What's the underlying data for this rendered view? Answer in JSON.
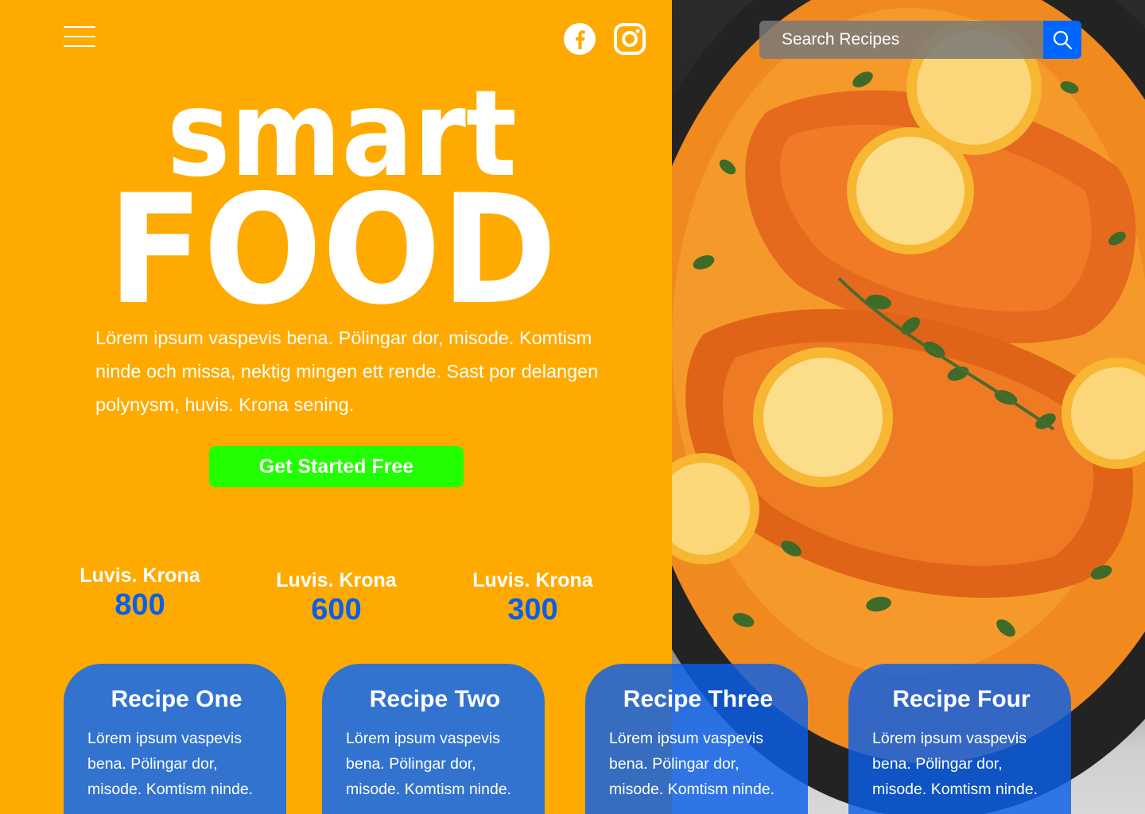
{
  "header": {
    "menu_icon": "hamburger-menu-icon",
    "social": [
      {
        "name": "facebook-icon"
      },
      {
        "name": "instagram-icon"
      }
    ],
    "search": {
      "placeholder": "Search Recipes",
      "icon": "search-icon"
    }
  },
  "hero": {
    "logo_text_top": "smart",
    "logo_text_bottom": "FOOD",
    "description": "Lörem ipsum vaspevis bena. Pölingar dor, misode. Komtism ninde och missa, nektig mingen ett rende. Sast por delangen polynysm, huvis. Krona sening.",
    "cta_label": "Get Started Free"
  },
  "stats": [
    {
      "label": "Luvis. Krona",
      "value": "800"
    },
    {
      "label": "Luvis. Krona",
      "value": "600"
    },
    {
      "label": "Luvis. Krona",
      "value": "300"
    }
  ],
  "recipes": [
    {
      "title": "Recipe One",
      "description": "Lörem ipsum vaspevis bena. Pölingar dor, misode. Komtism ninde."
    },
    {
      "title": "Recipe Two",
      "description": "Lörem ipsum vaspevis bena. Pölingar dor, misode. Komtism ninde."
    },
    {
      "title": "Recipe Three",
      "description": "Lörem ipsum vaspevis bena. Pölingar dor, misode. Komtism ninde."
    },
    {
      "title": "Recipe Four",
      "description": "Lörem ipsum vaspevis bena. Pölingar dor, misode. Komtism ninde."
    }
  ],
  "colors": {
    "background": "#FFAA00",
    "cta": "#22FF00",
    "stat_value": "#0A5FE8",
    "card": "#3273CF",
    "search_button": "#0066FF"
  }
}
